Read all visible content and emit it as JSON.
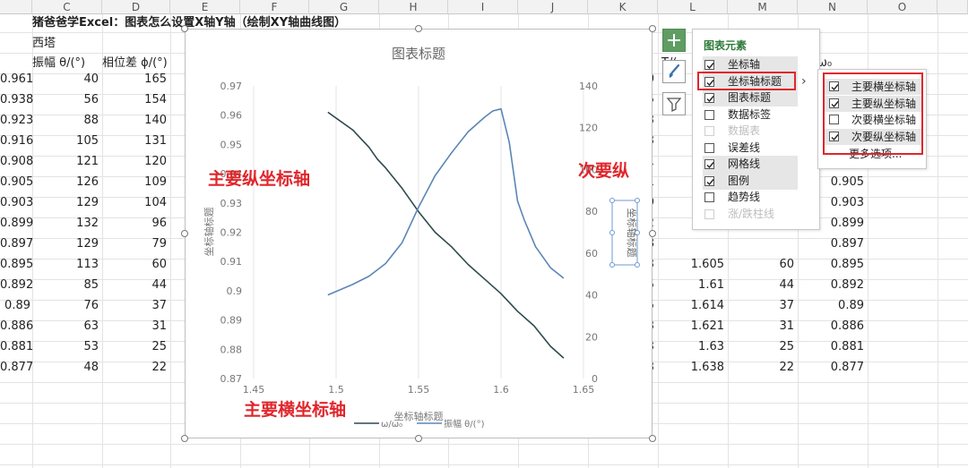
{
  "title": "猪爸爸学Excel：图表怎么设置X轴Y轴（绘制XY轴曲线图）",
  "subtitle": "西塔",
  "columns": [
    "C",
    "D",
    "E",
    "F",
    "G",
    "H",
    "I",
    "J",
    "K",
    "L",
    "M",
    "N",
    "O"
  ],
  "headers": {
    "c": "振幅 θ/(°)",
    "d": "相位差 ϕ/(°)",
    "l_partial": "T/(",
    "n_partial": "ω₀"
  },
  "rows": [
    {
      "b": "0.961",
      "c": "40",
      "d": "165",
      "k": "0",
      "l": "",
      "m": "",
      "n": ""
    },
    {
      "b": "0.938",
      "c": "56",
      "d": "154",
      "k": "5",
      "l": "",
      "m": "",
      "n": ""
    },
    {
      "b": "0.923",
      "c": "88",
      "d": "140",
      "k": "3",
      "l": "",
      "m": "",
      "n": ""
    },
    {
      "b": "0.916",
      "c": "105",
      "d": "131",
      "k": "3",
      "l": "",
      "m": "",
      "n": ""
    },
    {
      "b": "0.908",
      "c": "121",
      "d": "120",
      "k": "1",
      "l": "",
      "m": "",
      "n": ""
    },
    {
      "b": "0.905",
      "c": "126",
      "d": "109",
      "k": "1",
      "l": "",
      "m": "",
      "n": "0.905"
    },
    {
      "b": "0.903",
      "c": "129",
      "d": "104",
      "k": "9",
      "l": "",
      "m": "",
      "n": "0.903"
    },
    {
      "b": "0.899",
      "c": "132",
      "d": "96",
      "k": "2",
      "l": "",
      "m": "",
      "n": "0.899"
    },
    {
      "b": "0.897",
      "c": "129",
      "d": "79",
      "k": "8",
      "l": "",
      "m": "",
      "n": "0.897"
    },
    {
      "b": "0.895",
      "c": "113",
      "d": "60",
      "k": "3",
      "l": "1.605",
      "m": "60",
      "n": "0.895"
    },
    {
      "b": "0.892",
      "c": "85",
      "d": "44",
      "k": "5",
      "l": "1.61",
      "m": "44",
      "n": "0.892"
    },
    {
      "b": "0.89",
      "c": "76",
      "d": "37",
      "k": "5",
      "l": "1.614",
      "m": "37",
      "n": "0.89"
    },
    {
      "b": "0.886",
      "c": "63",
      "d": "31",
      "k": "3",
      "l": "1.621",
      "m": "31",
      "n": "0.886"
    },
    {
      "b": "0.881",
      "c": "53",
      "d": "25",
      "k": "3",
      "l": "1.63",
      "m": "25",
      "n": "0.881"
    },
    {
      "b": "0.877",
      "c": "48",
      "d": "22",
      "k": "3",
      "l": "1.638",
      "m": "22",
      "n": "0.877"
    }
  ],
  "chart": {
    "title": "图表标题",
    "primary_y_title": "坐标轴标题",
    "secondary_y_title": "坐标轴标题",
    "x_title": "坐标轴标题"
  },
  "chart_data": {
    "type": "line",
    "title": "图表标题",
    "xlabel": "坐标轴标题",
    "ylabel": "坐标轴标题",
    "y2label": "坐标轴标题",
    "xlim": [
      1.45,
      1.65
    ],
    "ylim": [
      0.87,
      0.97
    ],
    "y2lim": [
      0,
      140
    ],
    "xticks": [
      "1.45",
      "1.5",
      "1.55",
      "1.6",
      "1.65"
    ],
    "yticks": [
      "0.87",
      "0.88",
      "0.89",
      "0.9",
      "0.91",
      "0.92",
      "0.93",
      "0.94",
      "0.95",
      "0.96",
      "0.97"
    ],
    "y2ticks": [
      "0",
      "20",
      "40",
      "60",
      "80",
      "100",
      "120",
      "140"
    ],
    "legend_position": "bottom",
    "series": [
      {
        "name": "ω/ω₀",
        "axis": "primary",
        "color": "#2e4a4e",
        "x": [
          1.495,
          1.51,
          1.52,
          1.525,
          1.53,
          1.54,
          1.55,
          1.56,
          1.57,
          1.58,
          1.59,
          1.6,
          1.61,
          1.62,
          1.63,
          1.638
        ],
        "y": [
          0.961,
          0.955,
          0.949,
          0.945,
          0.942,
          0.935,
          0.927,
          0.92,
          0.915,
          0.909,
          0.904,
          0.899,
          0.893,
          0.888,
          0.881,
          0.877
        ]
      },
      {
        "name": "振幅 θ/(°)",
        "axis": "secondary",
        "color": "#5b86b6",
        "x": [
          1.495,
          1.51,
          1.52,
          1.53,
          1.54,
          1.55,
          1.56,
          1.57,
          1.58,
          1.59,
          1.595,
          1.6,
          1.605,
          1.61,
          1.614,
          1.621,
          1.63,
          1.638
        ],
        "y": [
          40,
          45,
          49,
          55,
          65,
          82,
          97,
          108,
          118,
          125,
          128,
          129,
          113,
          85,
          76,
          63,
          53,
          48
        ]
      }
    ]
  },
  "panel": {
    "title": "图表元素",
    "items": [
      {
        "label": "坐标轴",
        "checked": true,
        "disabled": false,
        "hl": true
      },
      {
        "label": "坐标轴标题",
        "checked": true,
        "disabled": false,
        "hl": true
      },
      {
        "label": "图表标题",
        "checked": true,
        "disabled": false,
        "hl": true
      },
      {
        "label": "数据标签",
        "checked": false,
        "disabled": false,
        "hl": false
      },
      {
        "label": "数据表",
        "checked": false,
        "disabled": true,
        "hl": false
      },
      {
        "label": "误差线",
        "checked": false,
        "disabled": false,
        "hl": false
      },
      {
        "label": "网格线",
        "checked": true,
        "disabled": false,
        "hl": true
      },
      {
        "label": "图例",
        "checked": true,
        "disabled": false,
        "hl": true
      },
      {
        "label": "趋势线",
        "checked": false,
        "disabled": false,
        "hl": false
      },
      {
        "label": "涨/跌柱线",
        "checked": false,
        "disabled": true,
        "hl": false
      }
    ],
    "arrow": "›"
  },
  "subpanel": {
    "items": [
      {
        "label": "主要横坐标轴",
        "checked": true,
        "hl": true
      },
      {
        "label": "主要纵坐标轴",
        "checked": true,
        "hl": true
      },
      {
        "label": "次要横坐标轴",
        "checked": false,
        "hl": false
      },
      {
        "label": "次要纵坐标轴",
        "checked": true,
        "hl": true
      }
    ],
    "more": "更多选项..."
  },
  "annotations": {
    "primary_y": "主要纵坐标轴",
    "secondary_y": "次要纵",
    "primary_x": "主要横坐标轴"
  },
  "colors": {
    "accent_red": "#e0262c",
    "plus_green": "#5f9d63",
    "series1": "#2e4a4e",
    "series2": "#5b86b6"
  }
}
